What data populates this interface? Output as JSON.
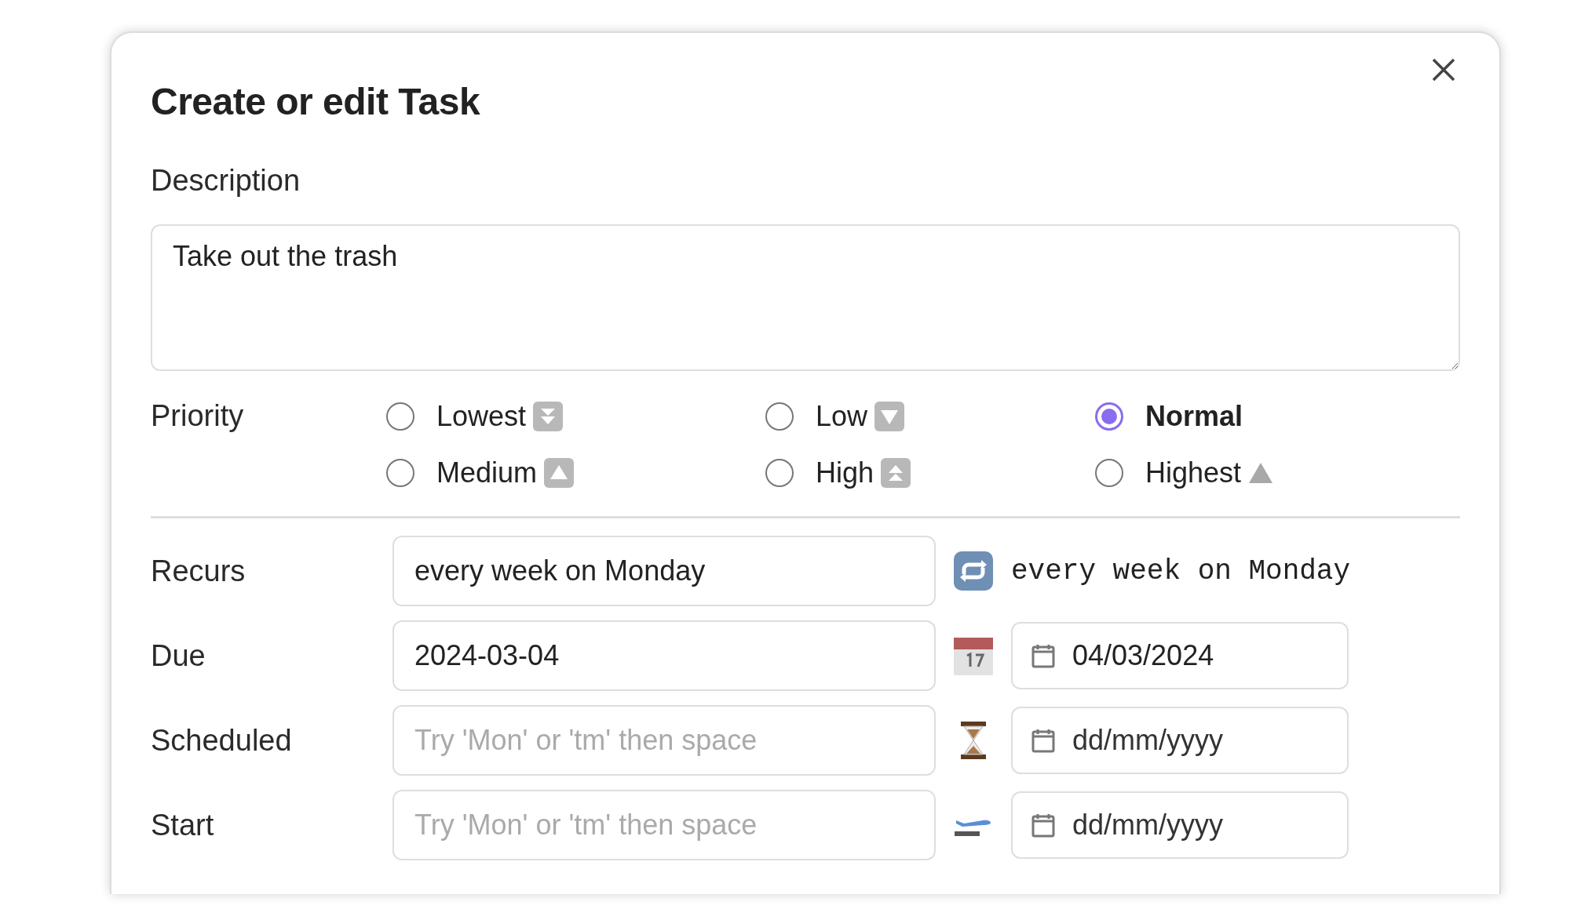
{
  "dialog": {
    "title": "Create or edit Task"
  },
  "description": {
    "label": "Description",
    "value": "Take out the trash"
  },
  "priority": {
    "label": "Priority",
    "options": [
      {
        "label": "Lowest",
        "selected": false
      },
      {
        "label": "Low",
        "selected": false
      },
      {
        "label": "Normal",
        "selected": true
      },
      {
        "label": "Medium",
        "selected": false
      },
      {
        "label": "High",
        "selected": false
      },
      {
        "label": "Highest",
        "selected": false
      }
    ]
  },
  "fields": [
    {
      "kind": "recurs",
      "label": "Recurs",
      "value": "every week on Monday",
      "preview": "every week on Monday"
    },
    {
      "kind": "date",
      "label": "Due",
      "value": "2024-03-04",
      "picker": {
        "value": "04/03/2024"
      }
    },
    {
      "kind": "date",
      "label": "Scheduled",
      "placeholder": "Try 'Mon' or 'tm' then space",
      "picker": {
        "placeholder": "dd/mm/yyyy"
      }
    },
    {
      "kind": "date",
      "label": "Start",
      "placeholder": "Try 'Mon' or 'tm' then space",
      "picker": {
        "placeholder": "dd/mm/yyyy"
      }
    }
  ]
}
